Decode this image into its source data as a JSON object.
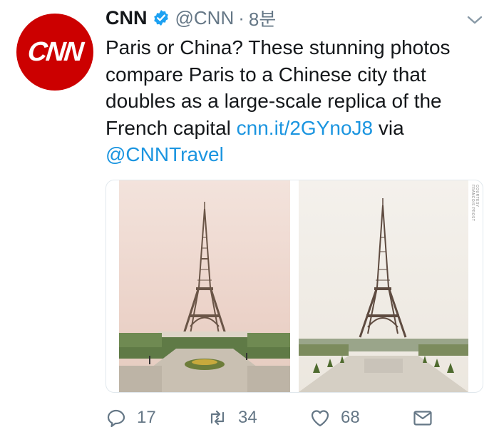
{
  "tweet": {
    "avatar_text": "CNN",
    "display_name": "CNN",
    "handle": "@CNN",
    "separator": "·",
    "time": "8분",
    "text_before": "Paris or China? These stunning photos compare Paris to a Chinese city that doubles as a large-scale replica of the French capital ",
    "link_url": "cnn.it/2GYnoJ8",
    "text_via": " via ",
    "mention": "@CNNTravel"
  },
  "media": {
    "credit": "COURTESY FRANCOIS PROST",
    "photos": [
      "eiffel-replica-photo",
      "eiffel-paris-photo"
    ]
  },
  "actions": {
    "reply_count": "17",
    "retweet_count": "34",
    "like_count": "68"
  },
  "colors": {
    "brand": "#cc0000",
    "link": "#1b95e0",
    "muted": "#657786",
    "verified": "#1da1f2"
  },
  "icons": [
    "verified-badge-icon",
    "chevron-down-icon",
    "reply-icon",
    "retweet-icon",
    "like-icon",
    "direct-message-icon"
  ]
}
